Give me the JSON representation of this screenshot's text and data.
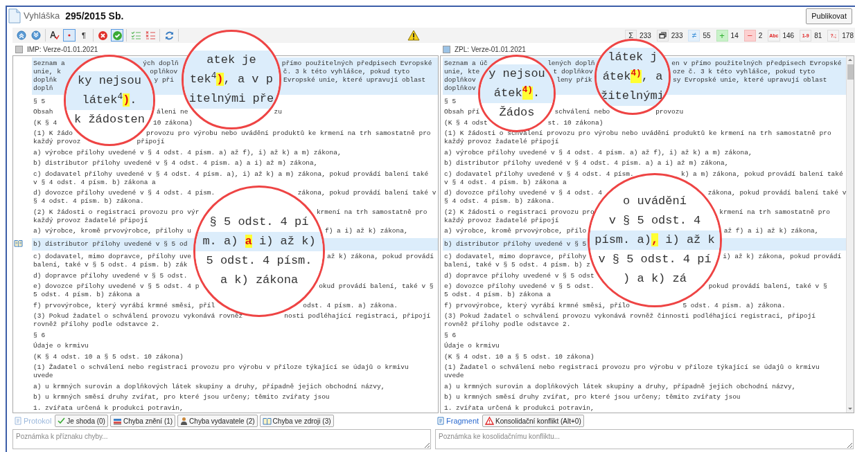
{
  "header": {
    "doc_type": "Vyhláška",
    "doc_number": "295/2015 Sb.",
    "publish_button": "Publikovat"
  },
  "toolbar": {
    "groups": [
      [
        {
          "kind": "up",
          "selected": false
        },
        {
          "kind": "down",
          "selected": false
        }
      ],
      [
        {
          "kind": "spell",
          "selected": false
        },
        {
          "kind": "dot",
          "selected": true
        },
        {
          "kind": "pilcrow",
          "label": "¶",
          "selected": false
        }
      ],
      [
        {
          "kind": "reject",
          "selected": false
        },
        {
          "kind": "accept",
          "selected": true
        }
      ],
      [
        {
          "kind": "check-list",
          "selected": false
        },
        {
          "kind": "cross-list",
          "selected": false
        }
      ],
      [
        {
          "kind": "refresh",
          "selected": false
        }
      ]
    ]
  },
  "stats": [
    {
      "kind": "sum",
      "symbol": "Σ",
      "value": "233"
    },
    {
      "kind": "windows",
      "value": "233"
    },
    {
      "kind": "changed",
      "symbol": "≠",
      "value": "55"
    },
    {
      "kind": "added",
      "symbol": "+",
      "value": "14"
    },
    {
      "kind": "removed",
      "symbol": "−",
      "value": "2"
    },
    {
      "kind": "error",
      "symbol": "Abc",
      "value": "146"
    },
    {
      "kind": "error",
      "symbol": "1-9",
      "value": "81"
    },
    {
      "kind": "error",
      "symbol": "?.;",
      "value": "178"
    }
  ],
  "panes": [
    {
      "label": "IMP: Verze-01.01.2021",
      "color": "#c8c8c8",
      "paragraphs": [
        {
          "kind": "highlighted",
          "lines": [
            [
              "Seznam a",
              "ých doplň",
              "přímo použitelných předpisech Evropské"
            ],
            [
              "unie, k",
              "oplňkov",
              "č. 3 k této vyhlášce, pokud tyto"
            ],
            [
              "doplňk",
              "y při",
              "Evropské unie, které upravují oblast"
            ],
            [
              "doplň"
            ]
          ]
        },
        {
          "kind": "plain",
          "lines": [
            [
              "§ 5"
            ]
          ]
        },
        {
          "kind": "plain",
          "lines": [
            [
              "Obsah",
              "áleni ne",
              "zu"
            ]
          ]
        },
        {
          "kind": "plain",
          "lines": [
            [
              "(K § 4",
              "10 zákona)"
            ]
          ]
        },
        {
          "kind": "plain",
          "lines": [
            [
              "(1) K žádo",
              "provozu pro výrobu nebo uvádění produktů ke krmení na trh samostatně pro"
            ],
            [
              "každý provoz",
              "připojí"
            ]
          ]
        },
        {
          "kind": "plain",
          "lines": [
            [
              "a) výrobce přílohy uvedené v § 4 odst. 4 písm. a) až f), i) až k) a m) zákona,"
            ]
          ]
        },
        {
          "kind": "plain",
          "lines": [
            [
              "b) distributor přílohy uvedené v § 4 odst. 4 písm. a) a i) až m) zákona,"
            ]
          ]
        },
        {
          "kind": "plain",
          "lines": [
            [
              "c) dodavatel přílohy uvedené v § 4 odst. 4 písm. a), i) až k) a m) zákona, pokud provádí balení také"
            ],
            [
              "v § 4 odst. 4 písm. b) zákona a"
            ]
          ]
        },
        {
          "kind": "plain",
          "lines": [
            [
              "d) dovozce přílohy uvedené v § 4 odst. 4 písm.",
              "zákona, pokud provádí balení také v"
            ],
            [
              "§ 4 odst. 4 písm. b) zákona."
            ]
          ]
        },
        {
          "kind": "plain",
          "lines": [
            [
              "(2) K žádosti o registraci provozu pro výr",
              "krmení na trh samostatně pro"
            ],
            [
              "každý provoz žadatelé připojí"
            ]
          ]
        },
        {
          "kind": "plain",
          "lines": [
            [
              "a) výrobce, kromě prvovýrobce, přílohy u",
              "f) a i) až k) zákona,"
            ]
          ]
        },
        {
          "kind": "bookmarked",
          "lines": [
            [
              "b) distributor přílohy uvedené v § 5 od"
            ]
          ]
        },
        {
          "kind": "plain",
          "lines": [
            [
              "c) dodavatel, mimo dopravce, přílohy uve",
              "až k) zákona, pokud provádí"
            ],
            [
              "balení, také v § 5 odst. 4 písm. b) zák"
            ]
          ]
        },
        {
          "kind": "plain",
          "lines": [
            [
              "d) dopravce přílohy uvedené v § 5 odst."
            ]
          ]
        },
        {
          "kind": "plain",
          "lines": [
            [
              "e) dovozce přílohy uvedené v § 5 odst. 4 p",
              "okud provádí balení, také v §"
            ],
            [
              "5 odst. 4 písm. b) zákona a"
            ]
          ]
        },
        {
          "kind": "plain",
          "lines": [
            [
              "f) prvovýrobce, který vyrábí krmné směsi, příl",
              "odst. 4 písm. a) zákona."
            ]
          ]
        },
        {
          "kind": "plain",
          "lines": [
            [
              "(3) Pokud žadatel o schválení provozu vykonává rovněž",
              "nosti podléhající registraci, připojí"
            ],
            [
              "rovněž přílohy podle odstavce 2."
            ]
          ]
        },
        {
          "kind": "plain",
          "lines": [
            [
              "§ 6"
            ]
          ]
        },
        {
          "kind": "plain",
          "lines": [
            [
              "Údaje o krmivu"
            ]
          ]
        },
        {
          "kind": "plain",
          "lines": [
            [
              "(K § 4 odst. 10 a § 5 odst. 10 zákona)"
            ]
          ]
        },
        {
          "kind": "plain",
          "lines": [
            [
              "(1) Žadatel o schválení nebo registraci provozu pro výrobu v příloze týkající se údajů o krmivu"
            ],
            [
              "uvede"
            ]
          ]
        },
        {
          "kind": "plain",
          "lines": [
            [
              "a) u krmných surovin a doplňkových látek skupiny a druhy, případně jejich obchodní názvy,"
            ]
          ]
        },
        {
          "kind": "plain",
          "lines": [
            [
              "b) u krmných směsí druhy zvířat, pro které jsou určeny; těmito zvířaty jsou"
            ]
          ]
        },
        {
          "kind": "plain",
          "lines": [
            [
              "1. zvířata určená k produkci potravin,"
            ]
          ]
        }
      ],
      "magnifiers": [
        {
          "rows": [
            {
              "highlighted": true,
              "parts": [
                {
                  "text": "ky nejsou",
                  "marked": false
                }
              ]
            },
            {
              "highlighted": true,
              "parts": [
                {
                  "text": "látek$^{4}$",
                  "marked": false
                },
                {
                  "text": ")",
                  "marked": true
                },
                {
                  "text": ".",
                  "marked": false
                }
              ]
            },
            {
              "highlighted": false,
              "parts": [
                {
                  "text": "k žádosten",
                  "marked": false
                }
              ]
            }
          ]
        },
        {
          "rows": [
            {
              "highlighted": true,
              "parts": [
                {
                  "text": "atek je",
                  "marked": false
                }
              ]
            },
            {
              "highlighted": true,
              "parts": [
                {
                  "text": "tek$^{4}$",
                  "marked": false
                },
                {
                  "text": ")",
                  "marked": true
                },
                {
                  "text": ", a v p",
                  "marked": false
                }
              ]
            },
            {
              "highlighted": true,
              "parts": [
                {
                  "text": "itelnými pře",
                  "marked": false
                }
              ]
            }
          ]
        },
        {
          "rows": [
            {
              "highlighted": false,
              "parts": [
                {
                  "text": "§ 5 odst. 4 pí",
                  "marked": false
                }
              ]
            },
            {
              "highlighted": true,
              "parts": [
                {
                  "text": "m. a) ",
                  "marked": false
                },
                {
                  "text": "a",
                  "marked": true
                },
                {
                  "text": " i) až k)",
                  "marked": false
                }
              ]
            },
            {
              "highlighted": false,
              "parts": [
                {
                  "text": "5 odst. 4 písm.",
                  "marked": false
                }
              ]
            },
            {
              "highlighted": false,
              "parts": [
                {
                  "text": "a k) zákona",
                  "marked": false
                }
              ]
            }
          ]
        }
      ]
    },
    {
      "label": "ZPL: Verze-01.01.2021",
      "color": "#9cc3e6",
      "paragraphs": [
        {
          "kind": "highlighted",
          "lines": [
            [
              "Seznam a úč",
              "lených doplň",
              "en v přímo použitelných předpisech Evropské"
            ],
            [
              "unie, kte",
              "t doplňkov",
              "oze č. 3 k této vyhlášce, pokud tyto"
            ],
            [
              "doplňkov",
              "leny přík",
              "sy Evropské unie, které upravují oblast"
            ],
            [
              "doplňkov"
            ]
          ]
        },
        {
          "kind": "plain",
          "lines": [
            [
              "§ 5"
            ]
          ]
        },
        {
          "kind": "plain",
          "lines": [
            [
              "Obsah pří",
              "schválení nebo",
              "provozu"
            ]
          ]
        },
        {
          "kind": "plain",
          "lines": [
            [
              "(K § 4 odst",
              "st. 10 zákona)"
            ]
          ]
        },
        {
          "kind": "plain",
          "lines": [
            [
              "(1) K žádosti o schválení provozu pro výrobu nebo uvádění produktů ke krmení na trh samostatně pro"
            ],
            [
              "každý provoz žadatelé připojí"
            ]
          ]
        },
        {
          "kind": "plain",
          "lines": [
            [
              "a) výrobce přílohy uvedené v § 4 odst. 4 písm. a) až f), i) až k) a m) zákona,"
            ]
          ]
        },
        {
          "kind": "plain",
          "lines": [
            [
              "b) distributor přílohy uvedené v § 4 odst. 4 písm. a) a i) až m) zákona,"
            ]
          ]
        },
        {
          "kind": "plain",
          "lines": [
            [
              "c) dodavatel přílohy uvedené v § 4 odst. 4 písm.",
              "k) a m) zákona, pokud provádí balení také"
            ],
            [
              "v § 4 odst. 4 písm. b) zákona a"
            ]
          ]
        },
        {
          "kind": "plain",
          "lines": [
            [
              "d) dovozce přílohy uvedené v § 4 odst. 4",
              "zákona, pokud provádí balení také v"
            ],
            [
              "§ 4 odst. 4 písm. b) zákona."
            ]
          ]
        },
        {
          "kind": "plain",
          "lines": [
            [
              "(2) K žádosti o registraci provozu pro",
              "krmení na trh samostatně pro"
            ],
            [
              "každý provoz žadatelé připojí"
            ]
          ]
        },
        {
          "kind": "plain",
          "lines": [
            [
              "a) výrobce, kromě prvovýrobce, přílo",
              "až f) a i) až k) zákona,"
            ]
          ]
        },
        {
          "kind": "highlighted",
          "lines": [
            [
              "b) distributor přílohy uvedené v § 5"
            ]
          ]
        },
        {
          "kind": "plain",
          "lines": [
            [
              "c) dodavatel, mimo dopravce, přílohy",
              "i) až k) zákona, pokud provádí"
            ],
            [
              "balení, také v § 5 odst. 4 písm. b) z"
            ]
          ]
        },
        {
          "kind": "plain",
          "lines": [
            [
              "d) dopravce přílohy uvedené v § 5 odst"
            ]
          ]
        },
        {
          "kind": "plain",
          "lines": [
            [
              "e) dovozce přílohy uvedené v § 5 odst.",
              "pokud provádí balení, také v §"
            ],
            [
              "5 odst. 4 písm. b) zákona a"
            ]
          ]
        },
        {
          "kind": "plain",
          "lines": [
            [
              "f) prvovýrobce, který vyrábí krmné směsi, přílo",
              "5 odst. 4 písm. a) zákona."
            ]
          ]
        },
        {
          "kind": "plain",
          "lines": [
            [
              "(3) Pokud žadatel o schválení provozu vykonává rovněž činnosti podléhající registraci, připojí"
            ],
            [
              "rovněž přílohy podle odstavce 2."
            ]
          ]
        },
        {
          "kind": "plain",
          "lines": [
            [
              "§ 6"
            ]
          ]
        },
        {
          "kind": "plain",
          "lines": [
            [
              "Údaje o krmivu"
            ]
          ]
        },
        {
          "kind": "plain",
          "lines": [
            [
              "(K § 4 odst. 10 a § 5 odst. 10 zákona)"
            ]
          ]
        },
        {
          "kind": "plain",
          "lines": [
            [
              "(1) Žadatel o schválení nebo registraci provozu pro výrobu v příloze týkající se údajů o krmivu"
            ],
            [
              "uvede"
            ]
          ]
        },
        {
          "kind": "plain",
          "lines": [
            [
              "a) u krmných surovin a doplňkových látek skupiny a druhy, případně jejich obchodní názvy,"
            ]
          ]
        },
        {
          "kind": "plain",
          "lines": [
            [
              "b) u krmných směsí druhy zvířat, pro které jsou určeny; těmito zvířaty jsou"
            ]
          ]
        },
        {
          "kind": "plain",
          "lines": [
            [
              "1. zvířata určená k produkci potravin,"
            ]
          ]
        }
      ],
      "magnifiers": [
        {
          "rows": [
            {
              "highlighted": true,
              "parts": [
                {
                  "text": "y nejsou",
                  "marked": false
                }
              ]
            },
            {
              "highlighted": true,
              "parts": [
                {
                  "text": "átek",
                  "marked": false
                },
                {
                  "text": "$^{4)}$",
                  "marked": true
                },
                {
                  "text": ".",
                  "marked": false
                }
              ]
            },
            {
              "highlighted": false,
              "parts": [
                {
                  "text": "Žádos",
                  "marked": false
                }
              ]
            }
          ]
        },
        {
          "rows": [
            {
              "highlighted": true,
              "parts": [
                {
                  "text": "látek j",
                  "marked": false
                }
              ]
            },
            {
              "highlighted": true,
              "parts": [
                {
                  "text": "átek",
                  "marked": false
                },
                {
                  "text": "$^{4)}$",
                  "marked": true
                },
                {
                  "text": ", a",
                  "marked": false
                }
              ]
            },
            {
              "highlighted": true,
              "parts": [
                {
                  "text": "žitelnými",
                  "marked": false
                }
              ]
            }
          ]
        },
        {
          "rows": [
            {
              "highlighted": false,
              "parts": [
                {
                  "text": "o uvádění",
                  "marked": false
                }
              ]
            },
            {
              "highlighted": false,
              "parts": [
                {
                  "text": "v § 5 odst. 4",
                  "marked": false
                }
              ]
            },
            {
              "highlighted": true,
              "parts": [
                {
                  "text": "písm. a)",
                  "marked": false
                },
                {
                  "text": ",",
                  "marked": true
                },
                {
                  "text": " i) až k",
                  "marked": false
                }
              ]
            },
            {
              "highlighted": false,
              "parts": [
                {
                  "text": "v § 5 odst. 4 pí",
                  "marked": false
                }
              ]
            },
            {
              "highlighted": false,
              "parts": [
                {
                  "text": ") a k) zá",
                  "marked": false
                }
              ]
            }
          ]
        }
      ]
    }
  ],
  "bottom": [
    {
      "tab": {
        "label": "Protokol",
        "disabled": true
      },
      "buttons": [
        {
          "kind": "match",
          "label": "Je shoda (0)"
        },
        {
          "kind": "wording",
          "label": "Chyba znění (1)"
        },
        {
          "kind": "publisher",
          "label": "Chyba vydavatele (2)"
        },
        {
          "kind": "source",
          "label": "Chyba ve zdroji (3)"
        }
      ],
      "note_placeholder": "Poznámka k příznaku chyby..."
    },
    {
      "tab": {
        "label": "Fragment",
        "disabled": false
      },
      "buttons": [
        {
          "kind": "conflict",
          "label": "Konsolidační konflikt (Alt+0)"
        }
      ],
      "note_placeholder": "Poznámka ke kosolidačnímu konfliktu..."
    }
  ]
}
